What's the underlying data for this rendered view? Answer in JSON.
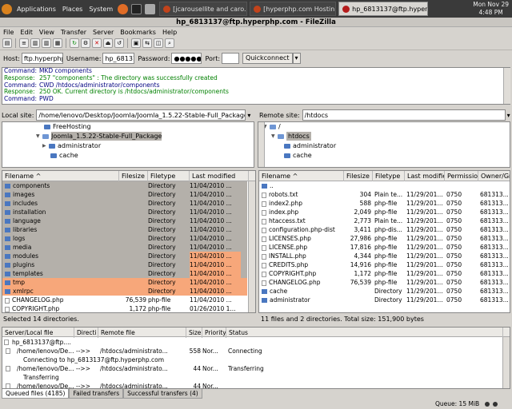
{
  "panel": {
    "menus": [
      "Applications",
      "Places",
      "System"
    ],
    "tasks": [
      "[jcarousellite and caro...",
      "[hyperphp.com Hostin...",
      "hp_6813137@ftp.hyperp..."
    ],
    "date": "Mon Nov 29",
    "time": "4:48 PM"
  },
  "window": {
    "title": "hp_6813137@ftp.hyperphp.com - FileZilla"
  },
  "menu": [
    "File",
    "Edit",
    "View",
    "Transfer",
    "Server",
    "Bookmarks",
    "Help"
  ],
  "conn": {
    "host_label": "Host:",
    "host": "ftp.hyperphp.",
    "user_label": "Username:",
    "user": "hp_68131",
    "pass_label": "Password:",
    "pass": "●●●●●",
    "port_label": "Port:",
    "port": "",
    "quick": "Quickconnect"
  },
  "log": [
    {
      "k": "Command:",
      "t": "MKD components",
      "c": "k"
    },
    {
      "k": "Response:",
      "t": "257 \"components\" : The directory was successfully created",
      "c": "ok"
    },
    {
      "k": "Command:",
      "t": "CWD /htdocs/administrator/components",
      "c": "k"
    },
    {
      "k": "Response:",
      "t": "250 OK. Current directory is /htdocs/administrator/components",
      "c": "ok"
    },
    {
      "k": "Command:",
      "t": "PWD",
      "c": "k"
    }
  ],
  "local": {
    "label": "Local site:",
    "path": "/home/lenovo/Desktop/Joomla/Joomla_1.5.22-Stable-Full_Package/",
    "tree": [
      "FreeHosting",
      "Joomla_1.5.22-Stable-Full_Package",
      "administrator",
      "cache"
    ],
    "cols": [
      "Filename ^",
      "Filesize",
      "Filetype",
      "Last modified"
    ],
    "files": [
      [
        "components",
        "",
        "Directory",
        "11/04/2010 ..."
      ],
      [
        "images",
        "",
        "Directory",
        "11/04/2010 ..."
      ],
      [
        "includes",
        "",
        "Directory",
        "11/04/2010 ..."
      ],
      [
        "installation",
        "",
        "Directory",
        "11/04/2010 ..."
      ],
      [
        "language",
        "",
        "Directory",
        "11/04/2010 ..."
      ],
      [
        "libraries",
        "",
        "Directory",
        "11/04/2010 ..."
      ],
      [
        "logs",
        "",
        "Directory",
        "11/04/2010 ..."
      ],
      [
        "media",
        "",
        "Directory",
        "11/04/2010 ..."
      ],
      [
        "modules",
        "",
        "Directory",
        "11/04/2010 ..."
      ],
      [
        "plugins",
        "",
        "Directory",
        "11/04/2010 ..."
      ],
      [
        "templates",
        "",
        "Directory",
        "11/04/2010 ..."
      ],
      [
        "tmp",
        "",
        "Directory",
        "11/04/2010 ..."
      ],
      [
        "xmlrpc",
        "",
        "Directory",
        "11/04/2010 ..."
      ],
      [
        "CHANGELOG.php",
        "76,539",
        "php-file",
        "11/04/2010 ..."
      ],
      [
        "COPYRIGHT.php",
        "1,172",
        "php-file",
        "01/26/2010 1..."
      ]
    ],
    "status": "Selected 14 directories."
  },
  "remote": {
    "label": "Remote site:",
    "path": "/htdocs",
    "tree": [
      "/",
      "htdocs",
      "administrator",
      "cache"
    ],
    "cols": [
      "Filename ^",
      "Filesize",
      "Filetype",
      "Last modified",
      "Permission",
      "Owner/Gr"
    ],
    "files": [
      [
        "..",
        "",
        "",
        "",
        "",
        ""
      ],
      [
        "robots.txt",
        "304",
        "Plain te...",
        "11/29/201...",
        "0750",
        "681313..."
      ],
      [
        "index2.php",
        "588",
        "php-file",
        "11/29/201...",
        "0750",
        "681313..."
      ],
      [
        "index.php",
        "2,049",
        "php-file",
        "11/29/201...",
        "0750",
        "681313..."
      ],
      [
        "htaccess.txt",
        "2,773",
        "Plain te...",
        "11/29/201...",
        "0750",
        "681313..."
      ],
      [
        "configuration.php-dist",
        "3,411",
        "php-dis...",
        "11/29/201...",
        "0750",
        "681313..."
      ],
      [
        "LICENSES.php",
        "27,986",
        "php-file",
        "11/29/201...",
        "0750",
        "681313..."
      ],
      [
        "LICENSE.php",
        "17,816",
        "php-file",
        "11/29/201...",
        "0750",
        "681313..."
      ],
      [
        "INSTALL.php",
        "4,344",
        "php-file",
        "11/29/201...",
        "0750",
        "681313..."
      ],
      [
        "CREDITS.php",
        "14,916",
        "php-file",
        "11/29/201...",
        "0750",
        "681313..."
      ],
      [
        "COPYRIGHT.php",
        "1,172",
        "php-file",
        "11/29/201...",
        "0750",
        "681313..."
      ],
      [
        "CHANGELOG.php",
        "76,539",
        "php-file",
        "11/29/201...",
        "0750",
        "681313..."
      ],
      [
        "cache",
        "",
        "Directory",
        "11/29/201...",
        "0750",
        "681313..."
      ],
      [
        "administrator",
        "",
        "Directory",
        "11/29/201...",
        "0750",
        "681313..."
      ]
    ],
    "status": "11 files and 2 directories. Total size: 151,900 bytes"
  },
  "queue": {
    "cols": [
      "Server/Local file",
      "Directi",
      "Remote file",
      "Size",
      "Priority",
      "Status"
    ],
    "rows": [
      [
        "hp_6813137@ftp....",
        "",
        "",
        "",
        "",
        ""
      ],
      [
        "/home/lenovo/De...",
        "-->>",
        "/htdocs/administrato...",
        "558",
        "Nor...",
        "Connecting"
      ],
      [
        "Connecting to hp_6813137@ftp.hyperphp.com",
        "",
        "",
        "",
        "",
        ""
      ],
      [
        "/home/lenovo/De...",
        "-->>",
        "/htdocs/administrato...",
        "44",
        "Nor...",
        "Transferring"
      ],
      [
        "Transferring",
        "",
        "",
        "",
        "",
        ""
      ],
      [
        "/home/lenovo/De...",
        "-->>",
        "/htdocs/administrato...",
        "44",
        "Nor...",
        ""
      ]
    ]
  },
  "tabs": [
    "Queued files (4185)",
    "Failed transfers",
    "Successful transfers (4)"
  ],
  "queue_size": "Queue: 15 MiB"
}
